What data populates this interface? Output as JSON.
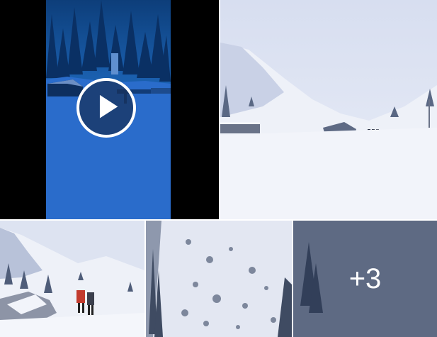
{
  "gallery": {
    "video_tile": {
      "icon": "play-icon"
    },
    "more_tile": {
      "count_label": "+3"
    }
  },
  "colors": {
    "video_blue": "#1f5aa8",
    "snow": "#eef1f7",
    "overlay": "#34425f"
  }
}
